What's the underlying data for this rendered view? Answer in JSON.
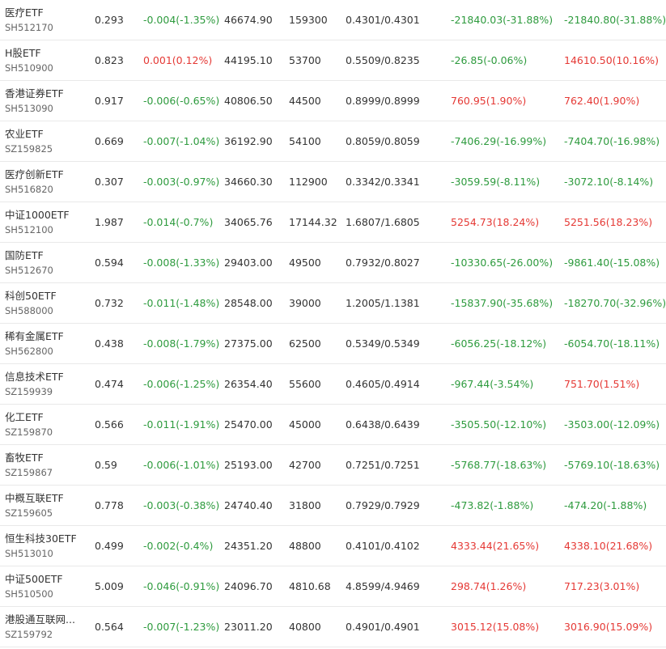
{
  "colors": {
    "up": "#e53935",
    "down": "#2e9b3e"
  },
  "rows": [
    {
      "name": "医疗ETF",
      "code": "SH512170",
      "price": "0.293",
      "change": "-0.004(-1.35%)",
      "change_dir": "down",
      "amount": "46674.90",
      "volume": "159300",
      "nav": "0.4301/0.4301",
      "profit1": "-21840.03(-31.88%)",
      "profit1_dir": "down",
      "profit2": "-21840.80(-31.88%)",
      "profit2_dir": "down"
    },
    {
      "name": "H股ETF",
      "code": "SH510900",
      "price": "0.823",
      "change": "0.001(0.12%)",
      "change_dir": "up",
      "amount": "44195.10",
      "volume": "53700",
      "nav": "0.5509/0.8235",
      "profit1": "-26.85(-0.06%)",
      "profit1_dir": "down",
      "profit2": "14610.50(10.16%)",
      "profit2_dir": "up"
    },
    {
      "name": "香港证券ETF",
      "code": "SH513090",
      "price": "0.917",
      "change": "-0.006(-0.65%)",
      "change_dir": "down",
      "amount": "40806.50",
      "volume": "44500",
      "nav": "0.8999/0.8999",
      "profit1": "760.95(1.90%)",
      "profit1_dir": "up",
      "profit2": "762.40(1.90%)",
      "profit2_dir": "up"
    },
    {
      "name": "农业ETF",
      "code": "SZ159825",
      "price": "0.669",
      "change": "-0.007(-1.04%)",
      "change_dir": "down",
      "amount": "36192.90",
      "volume": "54100",
      "nav": "0.8059/0.8059",
      "profit1": "-7406.29(-16.99%)",
      "profit1_dir": "down",
      "profit2": "-7404.70(-16.98%)",
      "profit2_dir": "down"
    },
    {
      "name": "医疗创新ETF",
      "code": "SH516820",
      "price": "0.307",
      "change": "-0.003(-0.97%)",
      "change_dir": "down",
      "amount": "34660.30",
      "volume": "112900",
      "nav": "0.3342/0.3341",
      "profit1": "-3059.59(-8.11%)",
      "profit1_dir": "down",
      "profit2": "-3072.10(-8.14%)",
      "profit2_dir": "down"
    },
    {
      "name": "中证1000ETF",
      "code": "SH512100",
      "price": "1.987",
      "change": "-0.014(-0.7%)",
      "change_dir": "down",
      "amount": "34065.76",
      "volume": "17144.32",
      "nav": "1.6807/1.6805",
      "profit1": "5254.73(18.24%)",
      "profit1_dir": "up",
      "profit2": "5251.56(18.23%)",
      "profit2_dir": "up"
    },
    {
      "name": "国防ETF",
      "code": "SH512670",
      "price": "0.594",
      "change": "-0.008(-1.33%)",
      "change_dir": "down",
      "amount": "29403.00",
      "volume": "49500",
      "nav": "0.7932/0.8027",
      "profit1": "-10330.65(-26.00%)",
      "profit1_dir": "down",
      "profit2": "-9861.40(-15.08%)",
      "profit2_dir": "down"
    },
    {
      "name": "科创50ETF",
      "code": "SH588000",
      "price": "0.732",
      "change": "-0.011(-1.48%)",
      "change_dir": "down",
      "amount": "28548.00",
      "volume": "39000",
      "nav": "1.2005/1.1381",
      "profit1": "-15837.90(-35.68%)",
      "profit1_dir": "down",
      "profit2": "-18270.70(-32.96%)",
      "profit2_dir": "down"
    },
    {
      "name": "稀有金属ETF",
      "code": "SH562800",
      "price": "0.438",
      "change": "-0.008(-1.79%)",
      "change_dir": "down",
      "amount": "27375.00",
      "volume": "62500",
      "nav": "0.5349/0.5349",
      "profit1": "-6056.25(-18.12%)",
      "profit1_dir": "down",
      "profit2": "-6054.70(-18.11%)",
      "profit2_dir": "down"
    },
    {
      "name": "信息技术ETF",
      "code": "SZ159939",
      "price": "0.474",
      "change": "-0.006(-1.25%)",
      "change_dir": "down",
      "amount": "26354.40",
      "volume": "55600",
      "nav": "0.4605/0.4914",
      "profit1": "-967.44(-3.54%)",
      "profit1_dir": "down",
      "profit2": "751.70(1.51%)",
      "profit2_dir": "up"
    },
    {
      "name": "化工ETF",
      "code": "SZ159870",
      "price": "0.566",
      "change": "-0.011(-1.91%)",
      "change_dir": "down",
      "amount": "25470.00",
      "volume": "45000",
      "nav": "0.6438/0.6439",
      "profit1": "-3505.50(-12.10%)",
      "profit1_dir": "down",
      "profit2": "-3503.00(-12.09%)",
      "profit2_dir": "down"
    },
    {
      "name": "畜牧ETF",
      "code": "SZ159867",
      "price": "0.59",
      "change": "-0.006(-1.01%)",
      "change_dir": "down",
      "amount": "25193.00",
      "volume": "42700",
      "nav": "0.7251/0.7251",
      "profit1": "-5768.77(-18.63%)",
      "profit1_dir": "down",
      "profit2": "-5769.10(-18.63%)",
      "profit2_dir": "down"
    },
    {
      "name": "中概互联ETF",
      "code": "SZ159605",
      "price": "0.778",
      "change": "-0.003(-0.38%)",
      "change_dir": "down",
      "amount": "24740.40",
      "volume": "31800",
      "nav": "0.7929/0.7929",
      "profit1": "-473.82(-1.88%)",
      "profit1_dir": "down",
      "profit2": "-474.20(-1.88%)",
      "profit2_dir": "down"
    },
    {
      "name": "恒生科技30ETF",
      "code": "SH513010",
      "price": "0.499",
      "change": "-0.002(-0.4%)",
      "change_dir": "down",
      "amount": "24351.20",
      "volume": "48800",
      "nav": "0.4101/0.4102",
      "profit1": "4333.44(21.65%)",
      "profit1_dir": "up",
      "profit2": "4338.10(21.68%)",
      "profit2_dir": "up"
    },
    {
      "name": "中证500ETF",
      "code": "SH510500",
      "price": "5.009",
      "change": "-0.046(-0.91%)",
      "change_dir": "down",
      "amount": "24096.70",
      "volume": "4810.68",
      "nav": "4.8599/4.9469",
      "profit1": "298.74(1.26%)",
      "profit1_dir": "up",
      "profit2": "717.23(3.01%)",
      "profit2_dir": "up"
    },
    {
      "name": "港股通互联网...",
      "code": "SZ159792",
      "price": "0.564",
      "change": "-0.007(-1.23%)",
      "change_dir": "down",
      "amount": "23011.20",
      "volume": "40800",
      "nav": "0.4901/0.4901",
      "profit1": "3015.12(15.08%)",
      "profit1_dir": "up",
      "profit2": "3016.90(15.09%)",
      "profit2_dir": "up"
    }
  ]
}
